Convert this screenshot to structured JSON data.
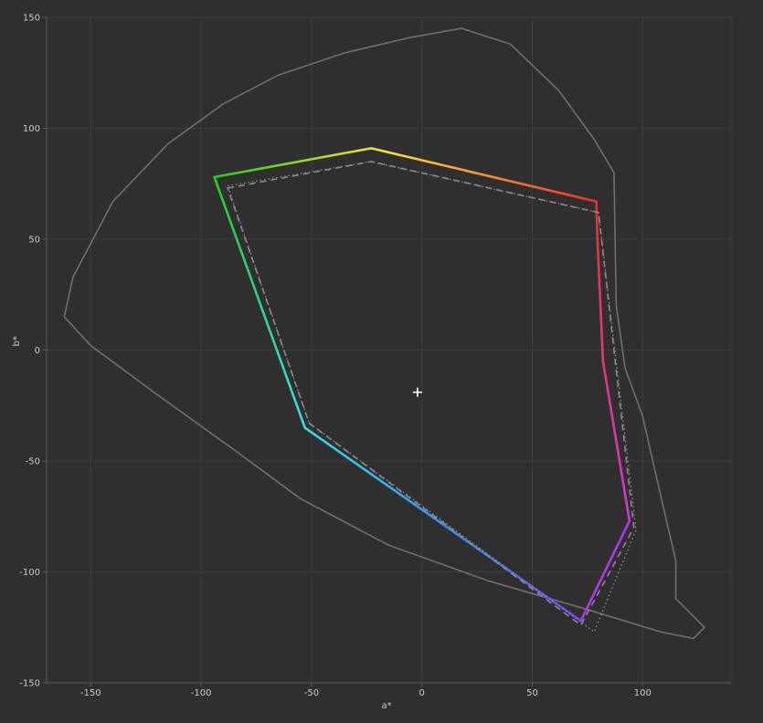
{
  "chart_data": {
    "type": "line",
    "title": "",
    "xlabel": "a*",
    "ylabel": "b*",
    "xlim": [
      -170,
      140
    ],
    "ylim": [
      -150,
      150
    ],
    "x_ticks": [
      -150,
      -100,
      -50,
      0,
      50,
      100
    ],
    "y_ticks": [
      150,
      100,
      50,
      0,
      -50,
      -100,
      -150
    ],
    "grid": true,
    "legend": "none",
    "colors": {
      "background": "#2f2f2f",
      "grid": "#3d3d3d",
      "axis": "#5a5a5a",
      "spectral_locus": "#6f6f6f",
      "reference": "#8a8a8a",
      "white_point": "#ffffff"
    },
    "series": [
      {
        "style": "spectral-locus",
        "x": [
          18,
          -5,
          -35,
          -65,
          -90,
          -115,
          -140,
          -158,
          -162,
          -150,
          -120,
          -85,
          -55,
          -15,
          30,
          75,
          108,
          123,
          128,
          115,
          115,
          108,
          100,
          92,
          88,
          87,
          78,
          62,
          40,
          18
        ],
        "y": [
          145,
          141,
          134,
          124,
          111,
          93,
          67,
          33,
          15,
          2,
          -20,
          -45,
          -67,
          -88,
          -104,
          -117,
          -127,
          -130,
          -125,
          -112,
          -95,
          -65,
          -30,
          -8,
          20,
          80,
          95,
          117,
          138,
          145
        ]
      },
      {
        "style": "measured-gamut",
        "x": [
          -94,
          -23,
          79,
          79.5,
          82,
          94,
          72,
          -53,
          -94
        ],
        "y": [
          78,
          91,
          67,
          50,
          -5,
          -77,
          -122,
          -35,
          78
        ],
        "vertex_colors": [
          "#22cc22",
          "#ffe238",
          "#e8312a",
          "#e8312a",
          "#e63572",
          "#d735d7",
          "#7a3cff",
          "#35dcea",
          "#22cc22"
        ]
      },
      {
        "style": "reference-gamut-dashed",
        "x": [
          -88,
          -23,
          80,
          96,
          72,
          -51,
          -88
        ],
        "y": [
          73,
          85,
          62,
          -80,
          -124,
          -33,
          73
        ]
      },
      {
        "style": "reference-gamut-dotted",
        "x": [
          -88,
          -23,
          80,
          97,
          78,
          -51,
          -88
        ],
        "y": [
          74,
          85,
          62,
          -81,
          -127,
          -33,
          74
        ]
      }
    ],
    "white_point": [
      -2,
      -19
    ]
  }
}
